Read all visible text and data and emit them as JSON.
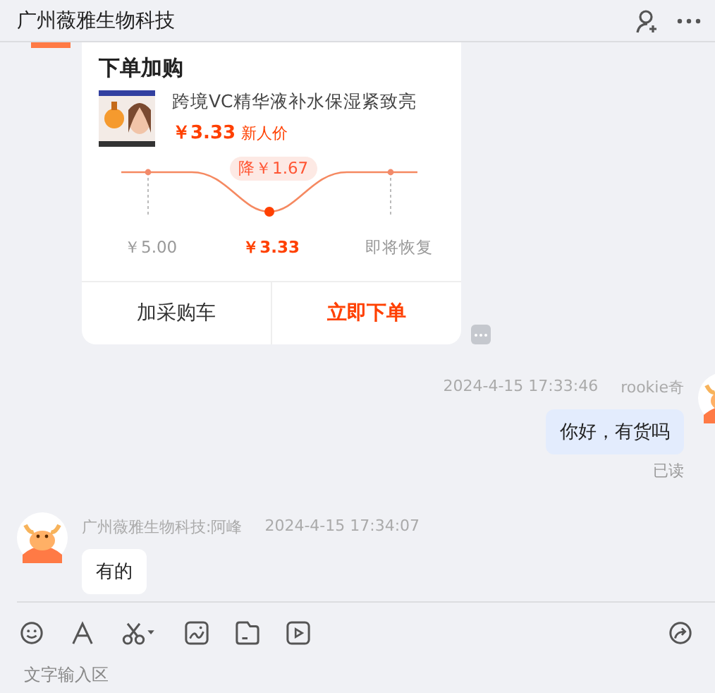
{
  "header": {
    "title": "广州薇雅生物科技"
  },
  "order_card": {
    "title": "下单加购",
    "product": {
      "name": "跨境VC精华液补水保湿紧致亮",
      "price": "￥3.33",
      "price_tag": "新人价"
    },
    "price_curve": {
      "drop_badge": "降￥1.67",
      "labels": [
        {
          "text": "￥5.00",
          "selected": false
        },
        {
          "text": "￥3.33",
          "selected": true
        },
        {
          "text": "即将恢复",
          "selected": false
        }
      ]
    },
    "buttons": [
      {
        "label": "加采购车",
        "primary": false
      },
      {
        "label": "立即下单",
        "primary": true
      }
    ]
  },
  "messages": [
    {
      "kind": "outgoing",
      "time": "2024-4-15 17:33:46",
      "sender": "rookie奇",
      "text": "你好，有货吗",
      "status": "已读"
    },
    {
      "kind": "incoming",
      "sender": "广州薇雅生物科技:阿峰",
      "time": "2024-4-15 17:34:07",
      "text": "有的"
    }
  ],
  "composer": {
    "placeholder": "文字输入区"
  }
}
